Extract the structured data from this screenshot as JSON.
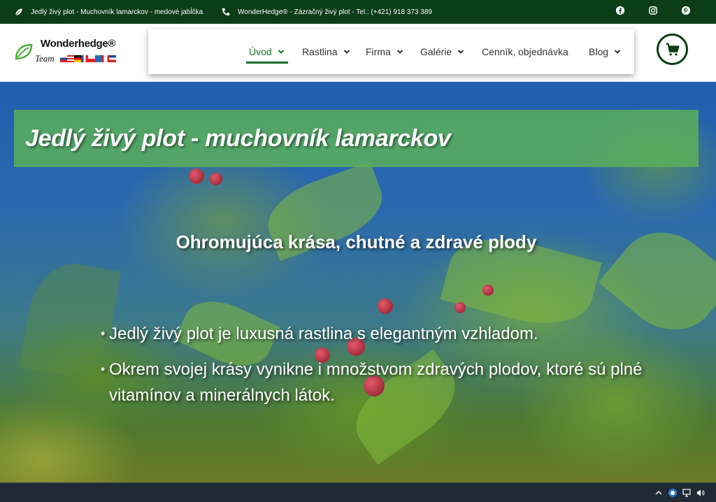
{
  "topbar": {
    "item1": "Jedlý živý plot - Muchovník lamarckov - medové jabĺčka",
    "item2": "WonderHedge® - Zázračný živý plot - Tel.: (+421) 918 373 389",
    "social": [
      "facebook-icon",
      "instagram-icon",
      "pinterest-icon"
    ]
  },
  "logo": {
    "brand": "Wonderhedge®",
    "team": "Team"
  },
  "nav": {
    "items": [
      {
        "label": "Úvod",
        "dropdown": true,
        "active": true
      },
      {
        "label": "Rastlina",
        "dropdown": true
      },
      {
        "label": "Firma",
        "dropdown": true
      },
      {
        "label": "Galérie",
        "dropdown": true
      },
      {
        "label": "Cenník, objednávka",
        "dropdown": false
      },
      {
        "label": "Blog",
        "dropdown": true
      }
    ],
    "cart_icon": "cart-icon"
  },
  "hero": {
    "title": "Jedlý živý plot - muchovník lamarckov",
    "subtitle": "Ohromujúca krása, chutné a zdravé plody",
    "bullets": [
      "Jedlý živý plot je luxusná rastlina s elegantným vzhladom.",
      "Okrem svojej krásy vynikne i množstvom zdravých plodov, ktoré sú plné vitamínov a minerálnych látok."
    ]
  },
  "colors": {
    "topbar_bg": "#0b3d16",
    "accent": "#18702c",
    "title_band": "#5aaf5a"
  }
}
